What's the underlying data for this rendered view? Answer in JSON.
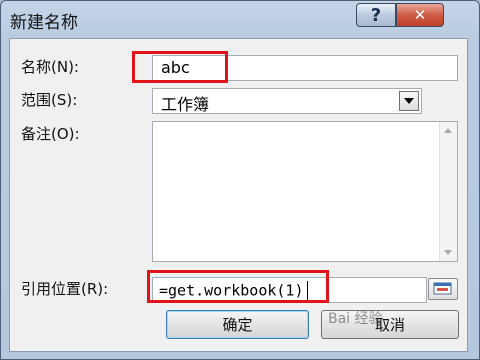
{
  "dialog": {
    "title": "新建名称",
    "help_glyph": "?",
    "close_glyph": "✕"
  },
  "form": {
    "name_label": "名称(N):",
    "name_value": "abc",
    "scope_label": "范围(S):",
    "scope_value": "工作簿",
    "comment_label": "备注(O):",
    "comment_value": "",
    "refers_label": "引用位置(R):",
    "refers_value": "=get.workbook(1)"
  },
  "buttons": {
    "ok_label": "确定",
    "cancel_label": "取消"
  },
  "watermark": "Bai 经验",
  "colors": {
    "highlight": "#e0121a",
    "close_button": "#c0432a"
  },
  "icons": {
    "help": "question-mark-icon",
    "close": "close-icon",
    "dropdown": "chevron-down-icon",
    "collapse": "collapse-dialog-icon"
  }
}
